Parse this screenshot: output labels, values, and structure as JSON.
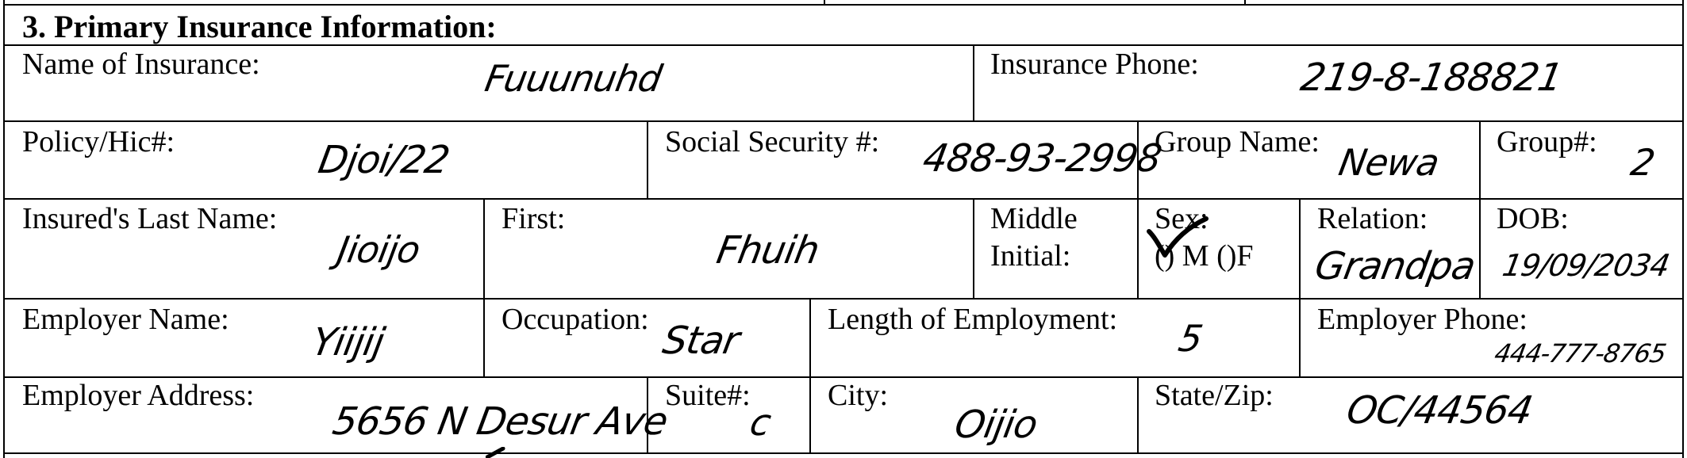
{
  "section": {
    "title": "3. Primary Insurance Information:"
  },
  "labels": {
    "name_of_insurance": "Name of Insurance:",
    "insurance_phone": "Insurance Phone:",
    "policy_hic": "Policy/Hic#:",
    "social_security": "Social Security #:",
    "group_name": "Group Name:",
    "group_number": "Group#:",
    "insured_last_name": "Insured's Last Name:",
    "first": "First:",
    "middle_initial_line1": "Middle",
    "middle_initial_line2": "Initial:",
    "sex": "Sex:",
    "sex_options": "() M ()F",
    "relation": "Relation:",
    "dob": "DOB:",
    "employer_name": "Employer Name:",
    "occupation": "Occupation:",
    "length_of_employment": "Length of Employment:",
    "employer_phone": "Employer Phone:",
    "employer_address": "Employer Address:",
    "suite": "Suite#:",
    "city": "City:",
    "state_zip": "State/Zip:"
  },
  "values": {
    "name_of_insurance": "Fuuunuhd",
    "insurance_phone": "219-8-188821",
    "policy_hic": "Djoi/22",
    "social_security": "488-93-2998",
    "group_name": "Newa",
    "group_number": "2",
    "insured_last_name": "Jioijo",
    "first": "Fhuih",
    "relation": "Grandpa",
    "dob": "19/09/2034",
    "employer_name": "Yiijij",
    "occupation": "Star",
    "length_of_employment": "5",
    "employer_phone": "444-777-8765",
    "employer_address": "5656 N Desur Ave",
    "suite": "c",
    "city": "Oijio",
    "state_zip": "OC/44564"
  },
  "sex_selection": "M",
  "icons": {
    "sex_check": "checkmark-icon"
  }
}
